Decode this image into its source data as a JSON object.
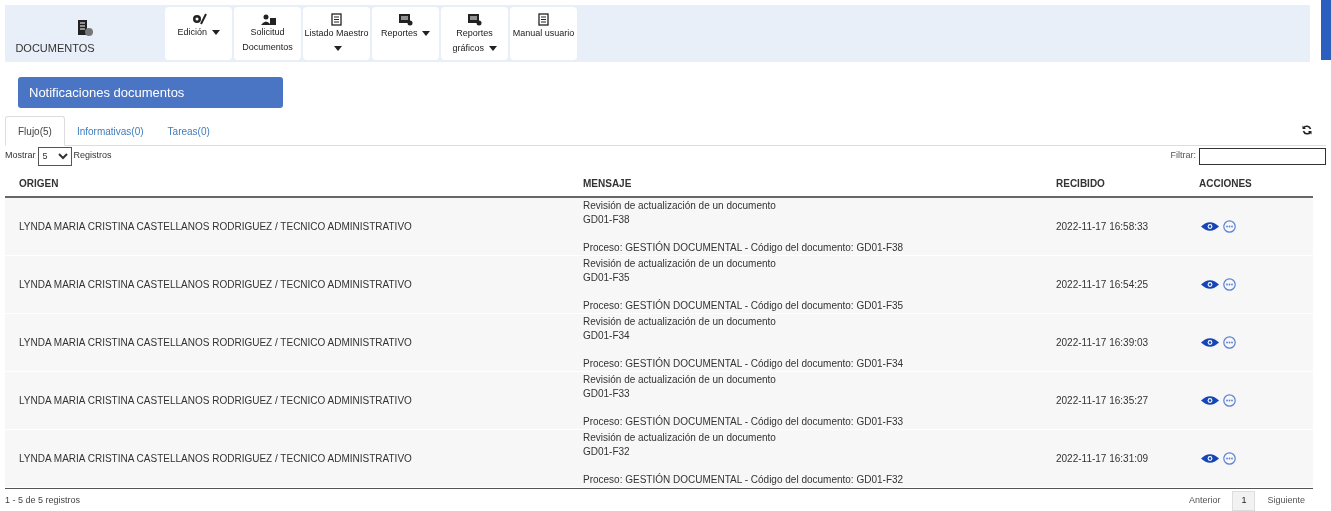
{
  "brand": {
    "label": "DOCUMENTOS"
  },
  "menu": [
    {
      "label": "Edición",
      "kind": "gear",
      "caret": true
    },
    {
      "label": "Solicitud Documentos",
      "kind": "person",
      "caret": false
    },
    {
      "label": "Listado Maestro",
      "kind": "doc",
      "caret": true
    },
    {
      "label": "Reportes",
      "kind": "report",
      "caret": true
    },
    {
      "label": "Reportes gráficos",
      "kind": "report",
      "caret": true
    },
    {
      "label": "Manual usuario",
      "kind": "doc",
      "caret": false
    }
  ],
  "title": "Notificaciones documentos",
  "tabs": [
    {
      "label": "Flujo(5)",
      "selected": true
    },
    {
      "label": "Informativas(0)",
      "selected": false
    },
    {
      "label": "Tareas(0)",
      "selected": false
    }
  ],
  "length": {
    "before": "Mostrar",
    "value": "5",
    "after": "Registros"
  },
  "filter": {
    "label": "Filtrar:"
  },
  "table": {
    "columns": [
      "ORIGEN",
      "MENSAJE",
      "RECIBIDO",
      "ACCIONES"
    ],
    "rows": [
      {
        "origen": "LYNDA MARIA CRISTINA CASTELLANOS RODRIGUEZ / TECNICO ADMINISTRATIVO",
        "mensaje": [
          "Revisión de actualización de un documento",
          "GD01-F38",
          "Proceso: GESTIÓN DOCUMENTAL - Código del documento: GD01-F38"
        ],
        "recibido": "2022-11-17 16:58:33"
      },
      {
        "origen": "LYNDA MARIA CRISTINA CASTELLANOS RODRIGUEZ / TECNICO ADMINISTRATIVO",
        "mensaje": [
          "Revisión de actualización de un documento",
          "GD01-F35",
          "Proceso: GESTIÓN DOCUMENTAL - Código del documento: GD01-F35"
        ],
        "recibido": "2022-11-17 16:54:25"
      },
      {
        "origen": "LYNDA MARIA CRISTINA CASTELLANOS RODRIGUEZ / TECNICO ADMINISTRATIVO",
        "mensaje": [
          "Revisión de actualización de un documento",
          "GD01-F34",
          "Proceso: GESTIÓN DOCUMENTAL - Código del documento: GD01-F34"
        ],
        "recibido": "2022-11-17 16:39:03"
      },
      {
        "origen": "LYNDA MARIA CRISTINA CASTELLANOS RODRIGUEZ / TECNICO ADMINISTRATIVO",
        "mensaje": [
          "Revisión de actualización de un documento",
          "GD01-F33",
          "Proceso: GESTIÓN DOCUMENTAL - Código del documento: GD01-F33"
        ],
        "recibido": "2022-11-17 16:35:27"
      },
      {
        "origen": "LYNDA MARIA CRISTINA CASTELLANOS RODRIGUEZ / TECNICO ADMINISTRATIVO",
        "mensaje": [
          "Revisión de actualización de un documento",
          "GD01-F32",
          "Proceso: GESTIÓN DOCUMENTAL - Código del documento: GD01-F32"
        ],
        "recibido": "2022-11-17 16:31:09"
      }
    ]
  },
  "info": "1 - 5 de 5 registros",
  "pagination": [
    {
      "label": "Anterior",
      "selected": false
    },
    {
      "label": "1",
      "selected": true
    },
    {
      "label": "Siguiente",
      "selected": false
    }
  ]
}
